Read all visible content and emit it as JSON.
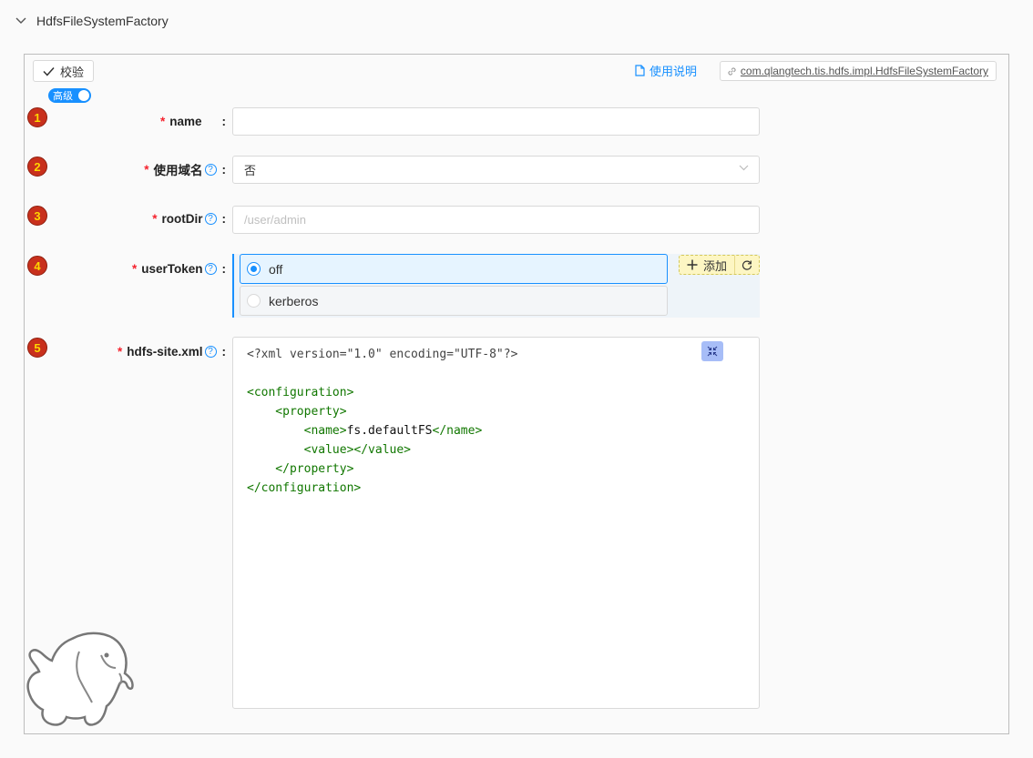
{
  "header": {
    "title": "HdfsFileSystemFactory",
    "toggle_icon": "chevron-down-icon"
  },
  "toolbar": {
    "validate_label": "校验",
    "advanced_toggle_label": "高级",
    "advanced_toggle_on": true,
    "doc_link_label": "使用说明",
    "class_name": "com.qlangtech.tis.hdfs.impl.HdfsFileSystemFactory"
  },
  "form": {
    "fields": [
      {
        "index": "1",
        "label": "name",
        "required": true,
        "has_help": false,
        "type": "text",
        "value": ""
      },
      {
        "index": "2",
        "label": "使用域名",
        "required": true,
        "has_help": true,
        "type": "select",
        "value": "否"
      },
      {
        "index": "3",
        "label": "rootDir",
        "required": true,
        "has_help": true,
        "type": "text",
        "value": "",
        "placeholder": "/user/admin"
      },
      {
        "index": "4",
        "label": "userToken",
        "required": true,
        "has_help": true,
        "type": "radio",
        "options": [
          {
            "label": "off",
            "selected": true
          },
          {
            "label": "kerberos",
            "selected": false
          }
        ],
        "add_label": "添加"
      },
      {
        "index": "5",
        "label": "hdfs-site.xml",
        "required": true,
        "has_help": true,
        "type": "code",
        "code_lines": [
          "<?xml version=\"1.0\" encoding=\"UTF-8\"?>",
          "",
          "<configuration>",
          "    <property>",
          "        <name>fs.defaultFS</name>",
          "        <value></value>",
          "    </property>",
          "</configuration>"
        ]
      }
    ],
    "required_mark": "*",
    "colon": ":",
    "help_mark": "?"
  },
  "colors": {
    "accent": "#1890ff",
    "required": "#f5222d",
    "badge_bg": "#c8301c",
    "badge_text": "#ffd700",
    "xml_tag": "#117700"
  }
}
